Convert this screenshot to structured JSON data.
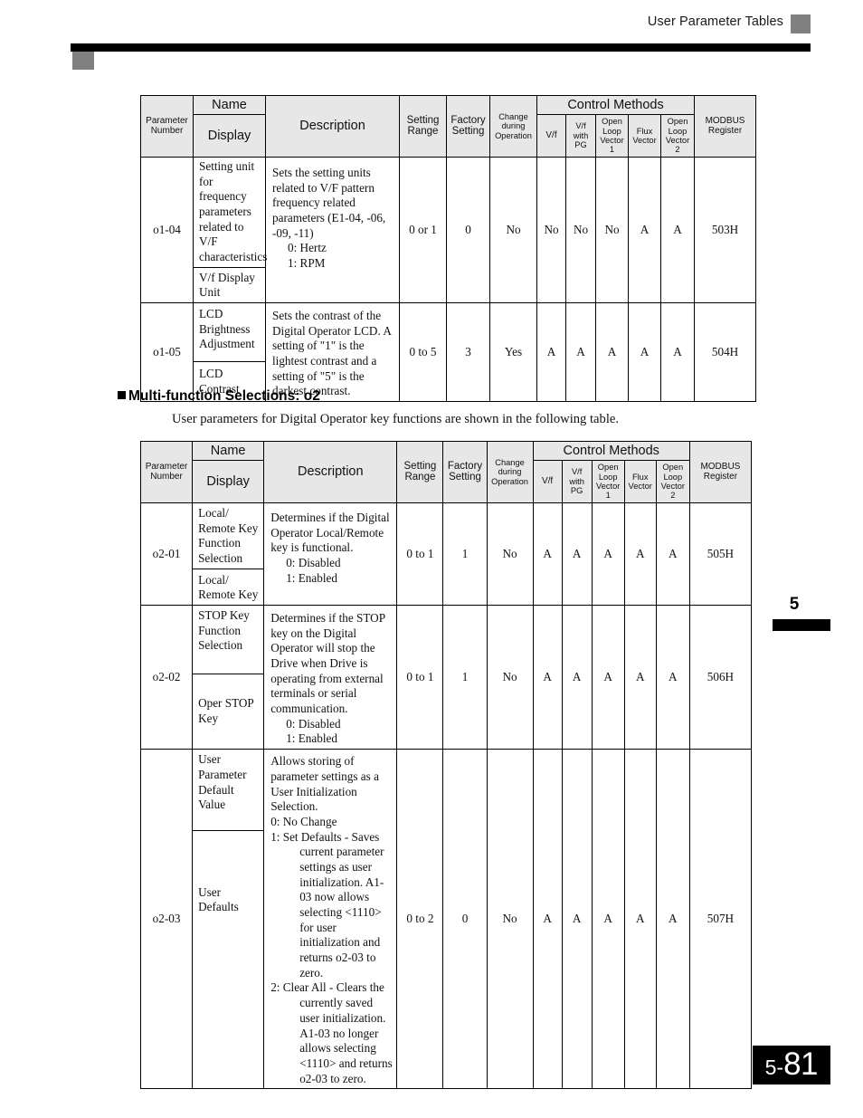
{
  "header": {
    "title": "User Parameter Tables"
  },
  "side_tab": {
    "chapter": "5"
  },
  "footer": {
    "chapter": "5-",
    "page": "81"
  },
  "columns": {
    "parameter_number": "Parameter\nNumber",
    "parameter_number_l1": "Parameter",
    "parameter_number_l2": "Number",
    "name": "Name",
    "display": "Display",
    "description": "Description",
    "setting_range_l1": "Setting",
    "setting_range_l2": "Range",
    "factory_setting_l1": "Factory",
    "factory_setting_l2": "Setting",
    "change_during_operation_l1": "Change",
    "change_during_operation_l2": "during",
    "change_during_operation_l3": "Operation",
    "control_methods": "Control Methods",
    "vf": "V/f",
    "vf_with_pg_l1": "V/f",
    "vf_with_pg_l2": "with",
    "vf_with_pg_l3": "PG",
    "olv1_l1": "Open",
    "olv1_l2": "Loop",
    "olv1_l3": "Vector",
    "olv1_l4": "1",
    "flux_vector_l1": "Flux",
    "flux_vector_l2": "Vector",
    "olv2_l1": "Open",
    "olv2_l2": "Loop",
    "olv2_l3": "Vector",
    "olv2_l4": "2",
    "modbus_l1": "MODBUS",
    "modbus_l2": "Register"
  },
  "section": {
    "heading": "Multi-function Selections: o2",
    "intro": "User parameters for Digital Operator key functions are shown in the following table."
  },
  "table1": {
    "rows": [
      {
        "number": "o1-04",
        "name": "Setting unit for frequency parameters related to V/F characteristics",
        "display": "V/f Display Unit",
        "desc_lead": "Sets the setting units related to V/F pattern frequency related parameters (E1-04, -06, -09, -11)",
        "desc_opt1": "0: Hertz",
        "desc_opt2": "1: RPM",
        "setting_range": "0 or 1",
        "factory_setting": "0",
        "change": "No",
        "vf": "No",
        "vf_pg": "No",
        "olv1": "No",
        "flux": "A",
        "olv2": "A",
        "modbus": "503H"
      },
      {
        "number": "o1-05",
        "name": "LCD Brightness Adjustment",
        "display": "LCD Contrast",
        "desc_lead": "Sets the contrast of the Digital Operator LCD. A setting of \"1\" is the lightest contrast and a setting of \"5\" is the darkest contrast.",
        "desc_opt1": "",
        "desc_opt2": "",
        "setting_range": "0 to 5",
        "factory_setting": "3",
        "change": "Yes",
        "vf": "A",
        "vf_pg": "A",
        "olv1": "A",
        "flux": "A",
        "olv2": "A",
        "modbus": "504H"
      }
    ]
  },
  "table2": {
    "rows": [
      {
        "number": "o2-01",
        "name": "Local/ Remote Key Function Selection",
        "display": "Local/ Remote Key",
        "desc_lead": "Determines if the Digital Operator Local/Remote key is functional.",
        "desc_opt1": "0: Disabled",
        "desc_opt2": "1: Enabled",
        "setting_range": "0 to 1",
        "factory_setting": "1",
        "change": "No",
        "vf": "A",
        "vf_pg": "A",
        "olv1": "A",
        "flux": "A",
        "olv2": "A",
        "modbus": "505H"
      },
      {
        "number": "o2-02",
        "name": "STOP Key Function Selection",
        "display": "Oper STOP Key",
        "desc_lead": "Determines if the STOP key on the Digital Operator will stop the Drive when Drive is operating from external terminals or serial communication.",
        "desc_opt1": "0: Disabled",
        "desc_opt2": "1: Enabled",
        "setting_range": "0 to 1",
        "factory_setting": "1",
        "change": "No",
        "vf": "A",
        "vf_pg": "A",
        "olv1": "A",
        "flux": "A",
        "olv2": "A",
        "modbus": "506H"
      },
      {
        "number": "o2-03",
        "name": "User Parameter Default Value",
        "display": "User Defaults",
        "desc_lead": "Allows storing of parameter settings as a User Initialization Selection.",
        "desc_opt0": "0: No Change",
        "desc_opt1": "1: Set Defaults - Saves",
        "desc_opt1_cont": "current parameter settings as user initialization. A1-03 now allows selecting <1110> for user initialization and returns o2-03 to zero.",
        "desc_opt2": "2: Clear All - Clears the",
        "desc_opt2_cont": "currently saved user initialization. A1-03 no longer allows selecting <1110> and returns o2-03 to zero.",
        "setting_range": "0 to 2",
        "factory_setting": "0",
        "change": "No",
        "vf": "A",
        "vf_pg": "A",
        "olv1": "A",
        "flux": "A",
        "olv2": "A",
        "modbus": "507H"
      }
    ]
  }
}
